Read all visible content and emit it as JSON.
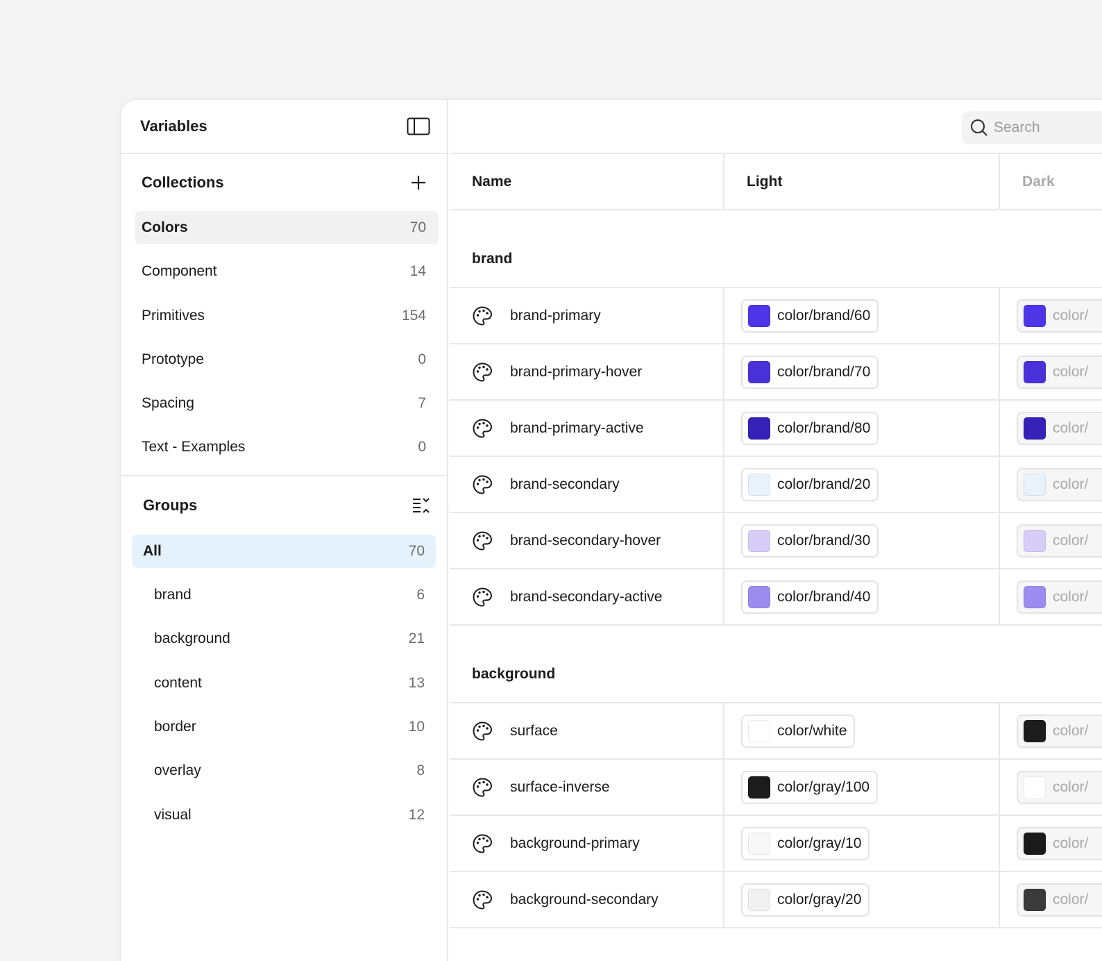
{
  "sidebar": {
    "title": "Variables",
    "collections_title": "Collections",
    "collections": [
      {
        "label": "Colors",
        "count": "70",
        "active": true
      },
      {
        "label": "Component",
        "count": "14"
      },
      {
        "label": "Primitives",
        "count": "154"
      },
      {
        "label": "Prototype",
        "count": "0"
      },
      {
        "label": "Spacing",
        "count": "7"
      },
      {
        "label": "Text - Examples",
        "count": "0"
      }
    ],
    "groups_title": "Groups",
    "groups": [
      {
        "label": "All",
        "count": "70",
        "active": true
      },
      {
        "label": "brand",
        "count": "6"
      },
      {
        "label": "background",
        "count": "21"
      },
      {
        "label": "content",
        "count": "13"
      },
      {
        "label": "border",
        "count": "10"
      },
      {
        "label": "overlay",
        "count": "8"
      },
      {
        "label": "visual",
        "count": "12"
      }
    ]
  },
  "search": {
    "placeholder": "Search"
  },
  "table": {
    "columns": [
      "Name",
      "Light",
      "Dark"
    ],
    "groups": [
      {
        "label": "brand",
        "rows": [
          {
            "name": "brand-primary",
            "light": "color/brand/60",
            "light_color": "#4f35e8",
            "dark_color": "#4f35e8"
          },
          {
            "name": "brand-primary-hover",
            "light": "color/brand/70",
            "light_color": "#4930d8",
            "dark_color": "#4930d8"
          },
          {
            "name": "brand-primary-active",
            "light": "color/brand/80",
            "light_color": "#3621b8",
            "dark_color": "#3621b8"
          },
          {
            "name": "brand-secondary",
            "light": "color/brand/20",
            "light_color": "#e9f1fb",
            "dark_color": "#e9f1fb"
          },
          {
            "name": "brand-secondary-hover",
            "light": "color/brand/30",
            "light_color": "#d6cdf8",
            "dark_color": "#d6cdf8"
          },
          {
            "name": "brand-secondary-active",
            "light": "color/brand/40",
            "light_color": "#9c8cf0",
            "dark_color": "#9c8cf0"
          }
        ]
      },
      {
        "label": "background",
        "rows": [
          {
            "name": "surface",
            "light": "color/white",
            "light_color": "#ffffff",
            "dark_color": "#1c1c1c"
          },
          {
            "name": "surface-inverse",
            "light": "color/gray/100",
            "light_color": "#1c1c1c",
            "dark_color": "#ffffff"
          },
          {
            "name": "background-primary",
            "light": "color/gray/10",
            "light_color": "#f8f8f8",
            "dark_color": "#1a1a1a"
          },
          {
            "name": "background-secondary",
            "light": "color/gray/20",
            "light_color": "#f1f1f1",
            "dark_color": "#3a3a3a"
          }
        ]
      }
    ],
    "dark_label_fragment": "color/"
  }
}
